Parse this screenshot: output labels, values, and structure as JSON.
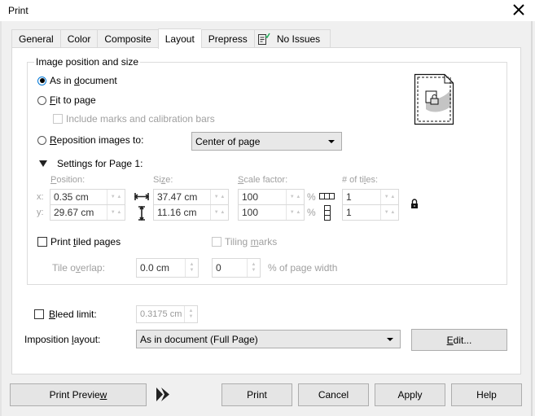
{
  "window": {
    "title": "Print",
    "close_icon": "close-x-icon"
  },
  "tabs": [
    {
      "label": "General",
      "active": false
    },
    {
      "label": "Color",
      "active": false
    },
    {
      "label": "Composite",
      "active": false
    },
    {
      "label": "Layout",
      "active": true
    },
    {
      "label": "Prepress",
      "active": false
    },
    {
      "label": "No Issues",
      "active": false,
      "icon": "checklist-icon"
    }
  ],
  "image_position": {
    "group_label": "Image position and size",
    "as_in_document": {
      "pre": "As in ",
      "ul": "d",
      "post": "ocument",
      "checked": true
    },
    "fit_to_page": {
      "pre": "",
      "ul": "F",
      "post": "it to page",
      "checked": false
    },
    "include_marks": {
      "label": "Include marks and calibration bars",
      "checked": false,
      "disabled": true
    },
    "reposition": {
      "pre": "",
      "ul": "R",
      "post": "eposition images to:",
      "checked": false
    },
    "reposition_select": "Center of page",
    "settings_label": "Settings for Page 1:",
    "position_label": {
      "ul": "P",
      "post": "osition:"
    },
    "size_label": {
      "pre": "Si",
      "ul": "z",
      "post": "e:"
    },
    "scale_label": {
      "ul": "S",
      "post": "cale factor:"
    },
    "tiles_label": {
      "pre": "# of ti",
      "ul": "l",
      "post": "es:"
    },
    "x_label": "x:",
    "y_label": "y:",
    "x_value": "0.35 cm",
    "y_value": "29.67 cm",
    "width_value": "37.47 cm",
    "height_value": "11.16 cm",
    "scale_x": "100",
    "scale_y": "100",
    "percent": "%",
    "tiles_x": "1",
    "tiles_y": "1",
    "print_tiled": {
      "pre": "Print ",
      "ul": "t",
      "post": "iled pages",
      "checked": false
    },
    "tiling_marks": {
      "pre": "Tiling ",
      "ul": "m",
      "post": "arks",
      "checked": false,
      "disabled": true
    },
    "tile_overlap_label": {
      "pre": "Tile o",
      "ul": "v",
      "post": "erlap:"
    },
    "tile_overlap_value": "0.0 cm",
    "page_width_value": "0",
    "page_width_label": "% of page width"
  },
  "bleed": {
    "pre": "",
    "ul": "B",
    "post": "leed limit:",
    "checked": false,
    "value": "0.3175 cm"
  },
  "imposition": {
    "pre": "Imposition ",
    "ul": "l",
    "post": "ayout:",
    "value": "As in document (Full Page)",
    "edit_ul": "E",
    "edit_post": "dit..."
  },
  "footer": {
    "print_preview": {
      "pre": "Print Previe",
      "ul": "w",
      "post": ""
    },
    "print": "Print",
    "cancel": "Cancel",
    "apply": "Apply",
    "help": "Help"
  }
}
